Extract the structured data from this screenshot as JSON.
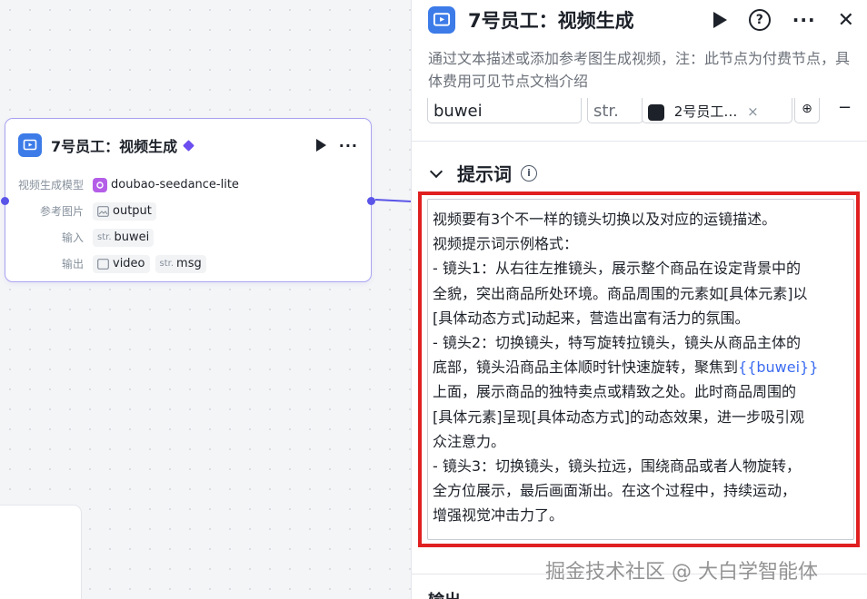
{
  "node": {
    "title": "7号员工：视频生成",
    "rows": {
      "model": {
        "label": "视频生成模型",
        "value": "doubao-seedance-lite"
      },
      "ref_image": {
        "label": "参考图片",
        "value": "output"
      },
      "input": {
        "label": "输入",
        "type_tag": "str.",
        "value": "buwei"
      },
      "output": {
        "label": "输出",
        "value1": "video",
        "type_tag": "str.",
        "value2": "msg"
      }
    }
  },
  "panel": {
    "title": "7号员工：视频生成",
    "description": "通过文本描述或添加参考图生成视频，注：此节点为付费节点，具体费用可见节点文档介绍",
    "input_row": {
      "name_value": "buwei",
      "type_value": "str.",
      "ref_value": "2号员工…",
      "remove_symbol": "×",
      "minus_symbol": "−"
    },
    "prompt_section": {
      "title": "提示词",
      "lines": [
        "视频要有3个不一样的镜头切换以及对应的运镜描述。",
        "视频提示词示例格式：",
        "- 镜头1：从右往左推镜头，展示整个商品在设定背景中的",
        "全貌，突出商品所处环境。商品周围的元素如[具体元素]以",
        "[具体动态方式]动起来，营造出富有活力的氛围。",
        "- 镜头2：切换镜头，特写旋转拉镜头，镜头从商品主体的",
        "底部，镜头沿商品主体顺时针快速旋转，聚焦到",
        "上面，展示商品的独特卖点或精致之处。此时商品周围的",
        "[具体元素]呈现[具体动态方式]的动态效果，进一步吸引观",
        "众注意力。",
        "- 镜头3：切换镜头，镜头拉远，围绕商品或者人物旋转，",
        "全方位展示，最后画面渐出。在这个过程中，持续运动，",
        "增强视觉冲击力了。"
      ],
      "variable": "{{buwei}}"
    },
    "output_section": {
      "title": "输出"
    }
  },
  "watermark": "掘金技术社区 @ 大白学智能体",
  "colors": {
    "accent": "#3c7be8",
    "highlight_border": "#e02020",
    "variable": "#3c6cf0",
    "node_border": "#a8a3f0"
  }
}
